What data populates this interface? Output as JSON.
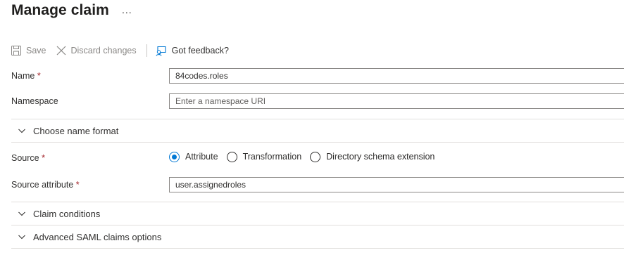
{
  "page": {
    "title": "Manage claim",
    "more_label": "..."
  },
  "toolbar": {
    "save_label": "Save",
    "discard_label": "Discard changes",
    "feedback_label": "Got feedback?"
  },
  "form": {
    "name": {
      "label": "Name",
      "required_mark": "*",
      "value": "84codes.roles"
    },
    "namespace": {
      "label": "Namespace",
      "placeholder": "Enter a namespace URI",
      "value": ""
    },
    "choose_name_format": {
      "label": "Choose name format"
    },
    "source": {
      "label": "Source",
      "required_mark": "*",
      "options": [
        {
          "label": "Attribute",
          "checked": true
        },
        {
          "label": "Transformation",
          "checked": false
        },
        {
          "label": "Directory schema extension",
          "checked": false
        }
      ]
    },
    "source_attribute": {
      "label": "Source attribute",
      "required_mark": "*",
      "value": "user.assignedroles"
    },
    "claim_conditions": {
      "label": "Claim conditions"
    },
    "advanced_saml": {
      "label": "Advanced SAML claims options"
    }
  },
  "colors": {
    "accent": "#0078d4",
    "required": "#a4262c",
    "disabled_text": "#8a8886",
    "divider": "#e1dfdd"
  },
  "icons": {
    "save": "save-icon",
    "discard": "close-icon",
    "feedback": "feedback-icon",
    "expand": "chevron-down-icon"
  }
}
